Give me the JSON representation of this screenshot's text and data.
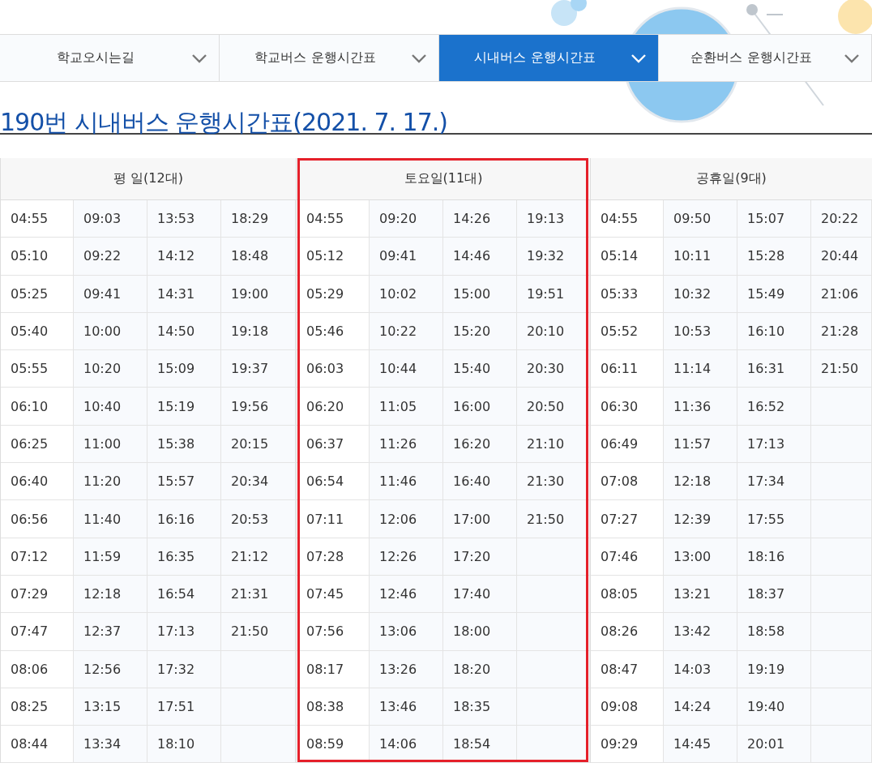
{
  "tabs": [
    {
      "label": "학교오시는길",
      "selected": false
    },
    {
      "label": "학교버스 운행시간표",
      "selected": false
    },
    {
      "label": "시내버스 운행시간표",
      "selected": true
    },
    {
      "label": "순환버스 운행시간표",
      "selected": false
    }
  ],
  "title": "190번 시내버스 운행시간표(2021. 7. 17.)",
  "groups": [
    {
      "header": "평 일(12대)",
      "highlighted": false,
      "rows": [
        [
          "04:55",
          "09:03",
          "13:53",
          "18:29"
        ],
        [
          "05:10",
          "09:22",
          "14:12",
          "18:48"
        ],
        [
          "05:25",
          "09:41",
          "14:31",
          "19:00"
        ],
        [
          "05:40",
          "10:00",
          "14:50",
          "19:18"
        ],
        [
          "05:55",
          "10:20",
          "15:09",
          "19:37"
        ],
        [
          "06:10",
          "10:40",
          "15:19",
          "19:56"
        ],
        [
          "06:25",
          "11:00",
          "15:38",
          "20:15"
        ],
        [
          "06:40",
          "11:20",
          "15:57",
          "20:34"
        ],
        [
          "06:56",
          "11:40",
          "16:16",
          "20:53"
        ],
        [
          "07:12",
          "11:59",
          "16:35",
          "21:12"
        ],
        [
          "07:29",
          "12:18",
          "16:54",
          "21:31"
        ],
        [
          "07:47",
          "12:37",
          "17:13",
          "21:50"
        ],
        [
          "08:06",
          "12:56",
          "17:32"
        ],
        [
          "08:25",
          "13:15",
          "17:51"
        ],
        [
          "08:44",
          "13:34",
          "18:10"
        ]
      ]
    },
    {
      "header": "토요일(11대)",
      "highlighted": true,
      "rows": [
        [
          "04:55",
          "09:20",
          "14:26",
          "19:13"
        ],
        [
          "05:12",
          "09:41",
          "14:46",
          "19:32"
        ],
        [
          "05:29",
          "10:02",
          "15:00",
          "19:51"
        ],
        [
          "05:46",
          "10:22",
          "15:20",
          "20:10"
        ],
        [
          "06:03",
          "10:44",
          "15:40",
          "20:30"
        ],
        [
          "06:20",
          "11:05",
          "16:00",
          "20:50"
        ],
        [
          "06:37",
          "11:26",
          "16:20",
          "21:10"
        ],
        [
          "06:54",
          "11:46",
          "16:40",
          "21:30"
        ],
        [
          "07:11",
          "12:06",
          "17:00",
          "21:50"
        ],
        [
          "07:28",
          "12:26",
          "17:20"
        ],
        [
          "07:45",
          "12:46",
          "17:40"
        ],
        [
          "07:56",
          "13:06",
          "18:00"
        ],
        [
          "08:17",
          "13:26",
          "18:20"
        ],
        [
          "08:38",
          "13:46",
          "18:35"
        ],
        [
          "08:59",
          "14:06",
          "18:54"
        ]
      ]
    },
    {
      "header": "공휴일(9대)",
      "highlighted": false,
      "rows": [
        [
          "04:55",
          "09:50",
          "15:07",
          "20:22"
        ],
        [
          "05:14",
          "10:11",
          "15:28",
          "20:44"
        ],
        [
          "05:33",
          "10:32",
          "15:49",
          "21:06"
        ],
        [
          "05:52",
          "10:53",
          "16:10",
          "21:28"
        ],
        [
          "06:11",
          "11:14",
          "16:31",
          "21:50"
        ],
        [
          "06:30",
          "11:36",
          "16:52"
        ],
        [
          "06:49",
          "11:57",
          "17:13"
        ],
        [
          "07:08",
          "12:18",
          "17:34"
        ],
        [
          "07:27",
          "12:39",
          "17:55"
        ],
        [
          "07:46",
          "13:00",
          "18:16"
        ],
        [
          "08:05",
          "13:21",
          "18:37"
        ],
        [
          "08:26",
          "13:42",
          "18:58"
        ],
        [
          "08:47",
          "14:03",
          "19:19"
        ],
        [
          "09:08",
          "14:24",
          "19:40"
        ],
        [
          "09:29",
          "14:45",
          "20:01"
        ]
      ]
    }
  ]
}
